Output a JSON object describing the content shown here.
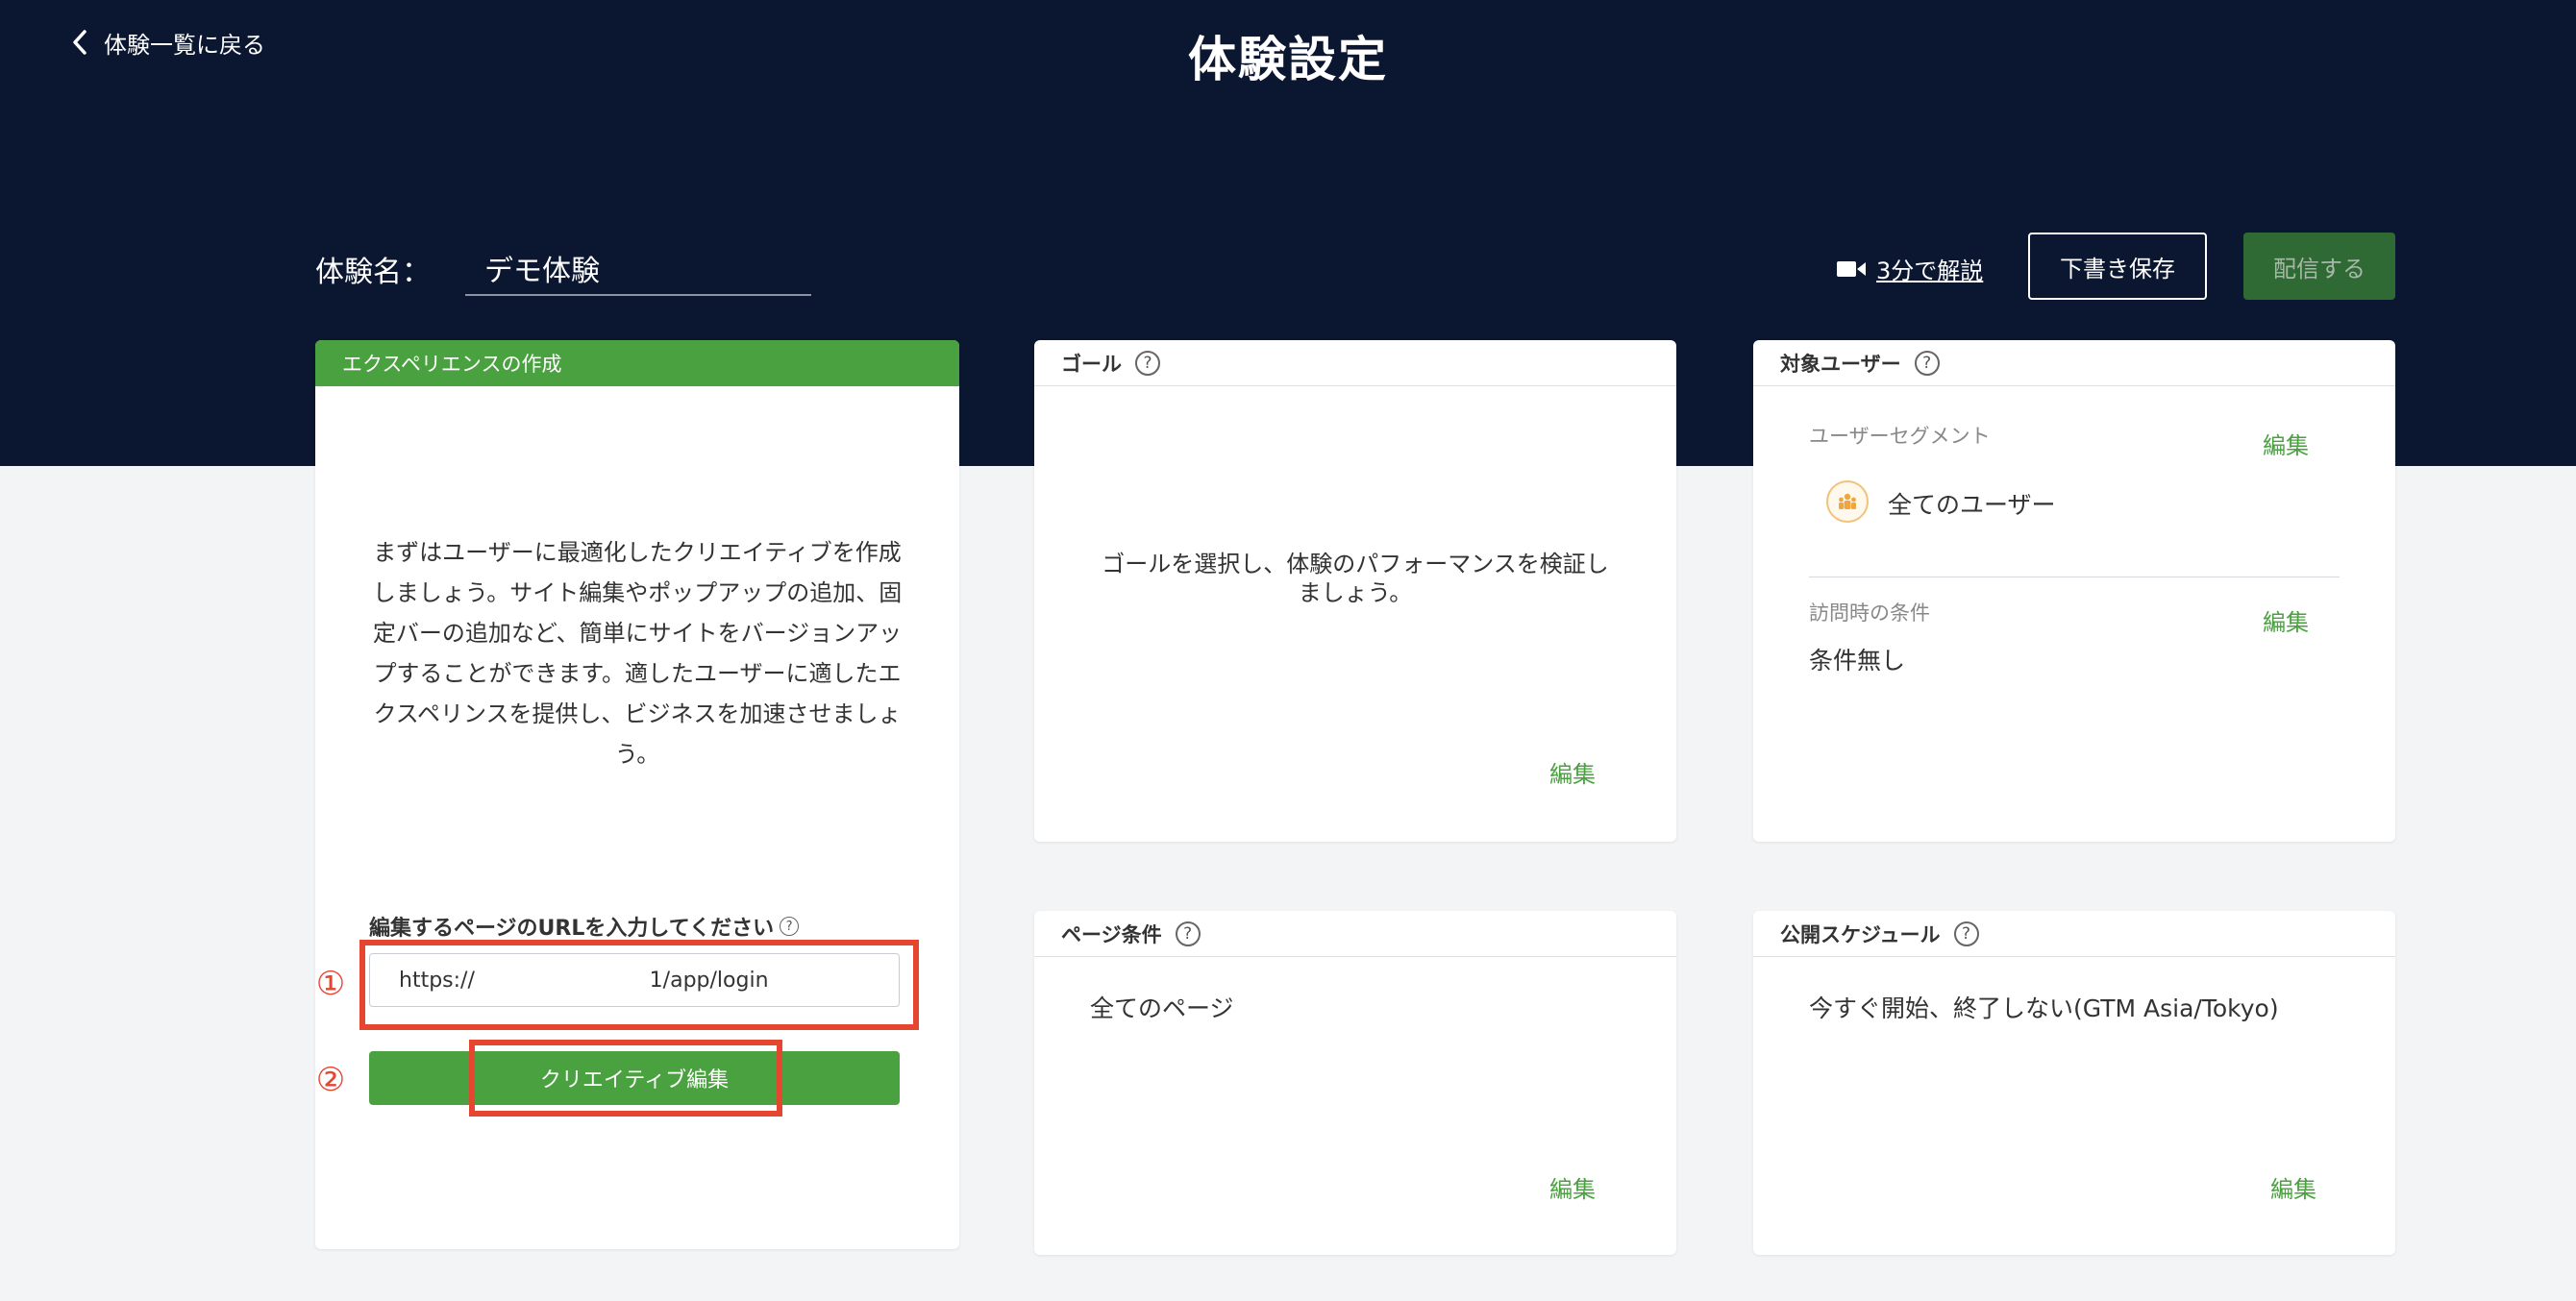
{
  "header": {
    "back_label": "体験一覧に戻る",
    "title": "体験設定",
    "name_label": "体験名：",
    "name_value": "デモ体験",
    "video_link": "3分で解説",
    "draft_button": "下書き保存",
    "publish_button": "配信する"
  },
  "creation_card": {
    "title": "エクスペリエンスの作成",
    "description": "まずはユーザーに最適化したクリエイティブを作成しましょう。サイト編集やポップアップの追加、固定バーの追加など、簡単にサイトをバージョンアップすることができます。適したユーザーに適したエクスペリンスを提供し、ビジネスを加速させましょう。",
    "url_label": "編集するページのURLを入力してください",
    "url_value": "https://                          1/app/login",
    "creative_button": "クリエイティブ編集",
    "step1": "①",
    "step2": "②"
  },
  "goal_card": {
    "title": "ゴール",
    "description": "ゴールを選択し、体験のパフォーマンスを検証しましょう。",
    "edit": "編集"
  },
  "target_card": {
    "title": "対象ユーザー",
    "segment_label": "ユーザーセグメント",
    "segment_edit": "編集",
    "segment_value": "全てのユーザー",
    "visit_label": "訪問時の条件",
    "visit_edit": "編集",
    "visit_value": "条件無し"
  },
  "page_condition_card": {
    "title": "ページ条件",
    "value": "全てのページ",
    "edit": "編集"
  },
  "schedule_card": {
    "title": "公開スケジュール",
    "value": "今すぐ開始、終了しない(GTM Asia/Tokyo)",
    "edit": "編集"
  },
  "colors": {
    "header_bg": "#0b1630",
    "accent_green": "#4aa13f",
    "highlight_red": "#e6452f"
  },
  "icons": [
    "chevron-left-icon",
    "video-camera-icon",
    "help-icon",
    "user-group-icon"
  ]
}
